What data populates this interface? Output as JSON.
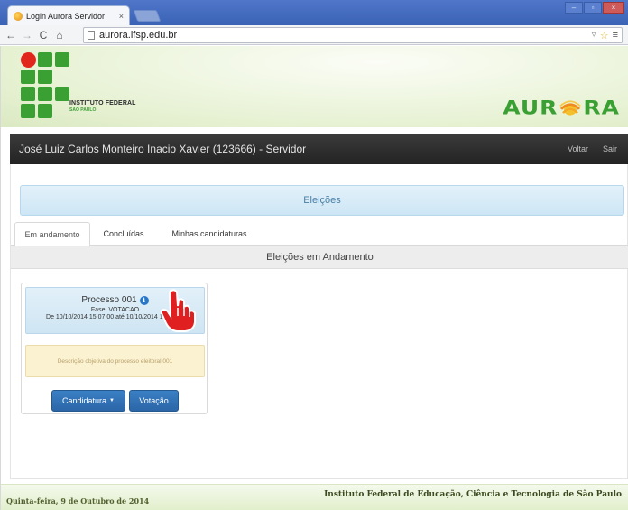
{
  "browser": {
    "tab_title": "Login Aurora Servidor",
    "tab_close": "×",
    "url": "aurora.ifsp.edu.br",
    "win_min": "–",
    "win_max": "▫",
    "win_close": "×"
  },
  "header": {
    "institute_name": "INSTITUTO FEDERAL",
    "institute_campus": "SÃO PAULO",
    "app_logo_left": "AUR",
    "app_logo_right": "RA"
  },
  "userbar": {
    "user": "José Luiz Carlos Monteiro Inacio Xavier (123666) - Servidor",
    "back_label": "Voltar",
    "logout_label": "Sair"
  },
  "main": {
    "banner_title": "Eleições",
    "tabs": [
      {
        "label": "Em andamento",
        "active": true
      },
      {
        "label": "Concluídas",
        "active": false
      },
      {
        "label": "Minhas candidaturas",
        "active": false
      }
    ],
    "section_title": "Eleições em Andamento",
    "card": {
      "title": "Processo 001",
      "info_glyph": "i",
      "phase": "Fase: VOTACAO",
      "dates": "De 10/10/2014 15:07:00 até 10/10/2014 17:07:00",
      "description": "Descrição objetiva do processo eleitoral 001",
      "btn_candidatura": "Candidatura",
      "btn_votacao": "Votação"
    }
  },
  "footer": {
    "date": "Quinta-feira, 9 de Outubro de 2014",
    "institution": "Instituto Federal de Educação, Ciência e Tecnologia de São Paulo"
  },
  "colors": {
    "if_green": "#3aa034",
    "if_red": "#e1261c",
    "primary_button": "#2b66a8",
    "userbar_bg": "#2b2b2b"
  }
}
